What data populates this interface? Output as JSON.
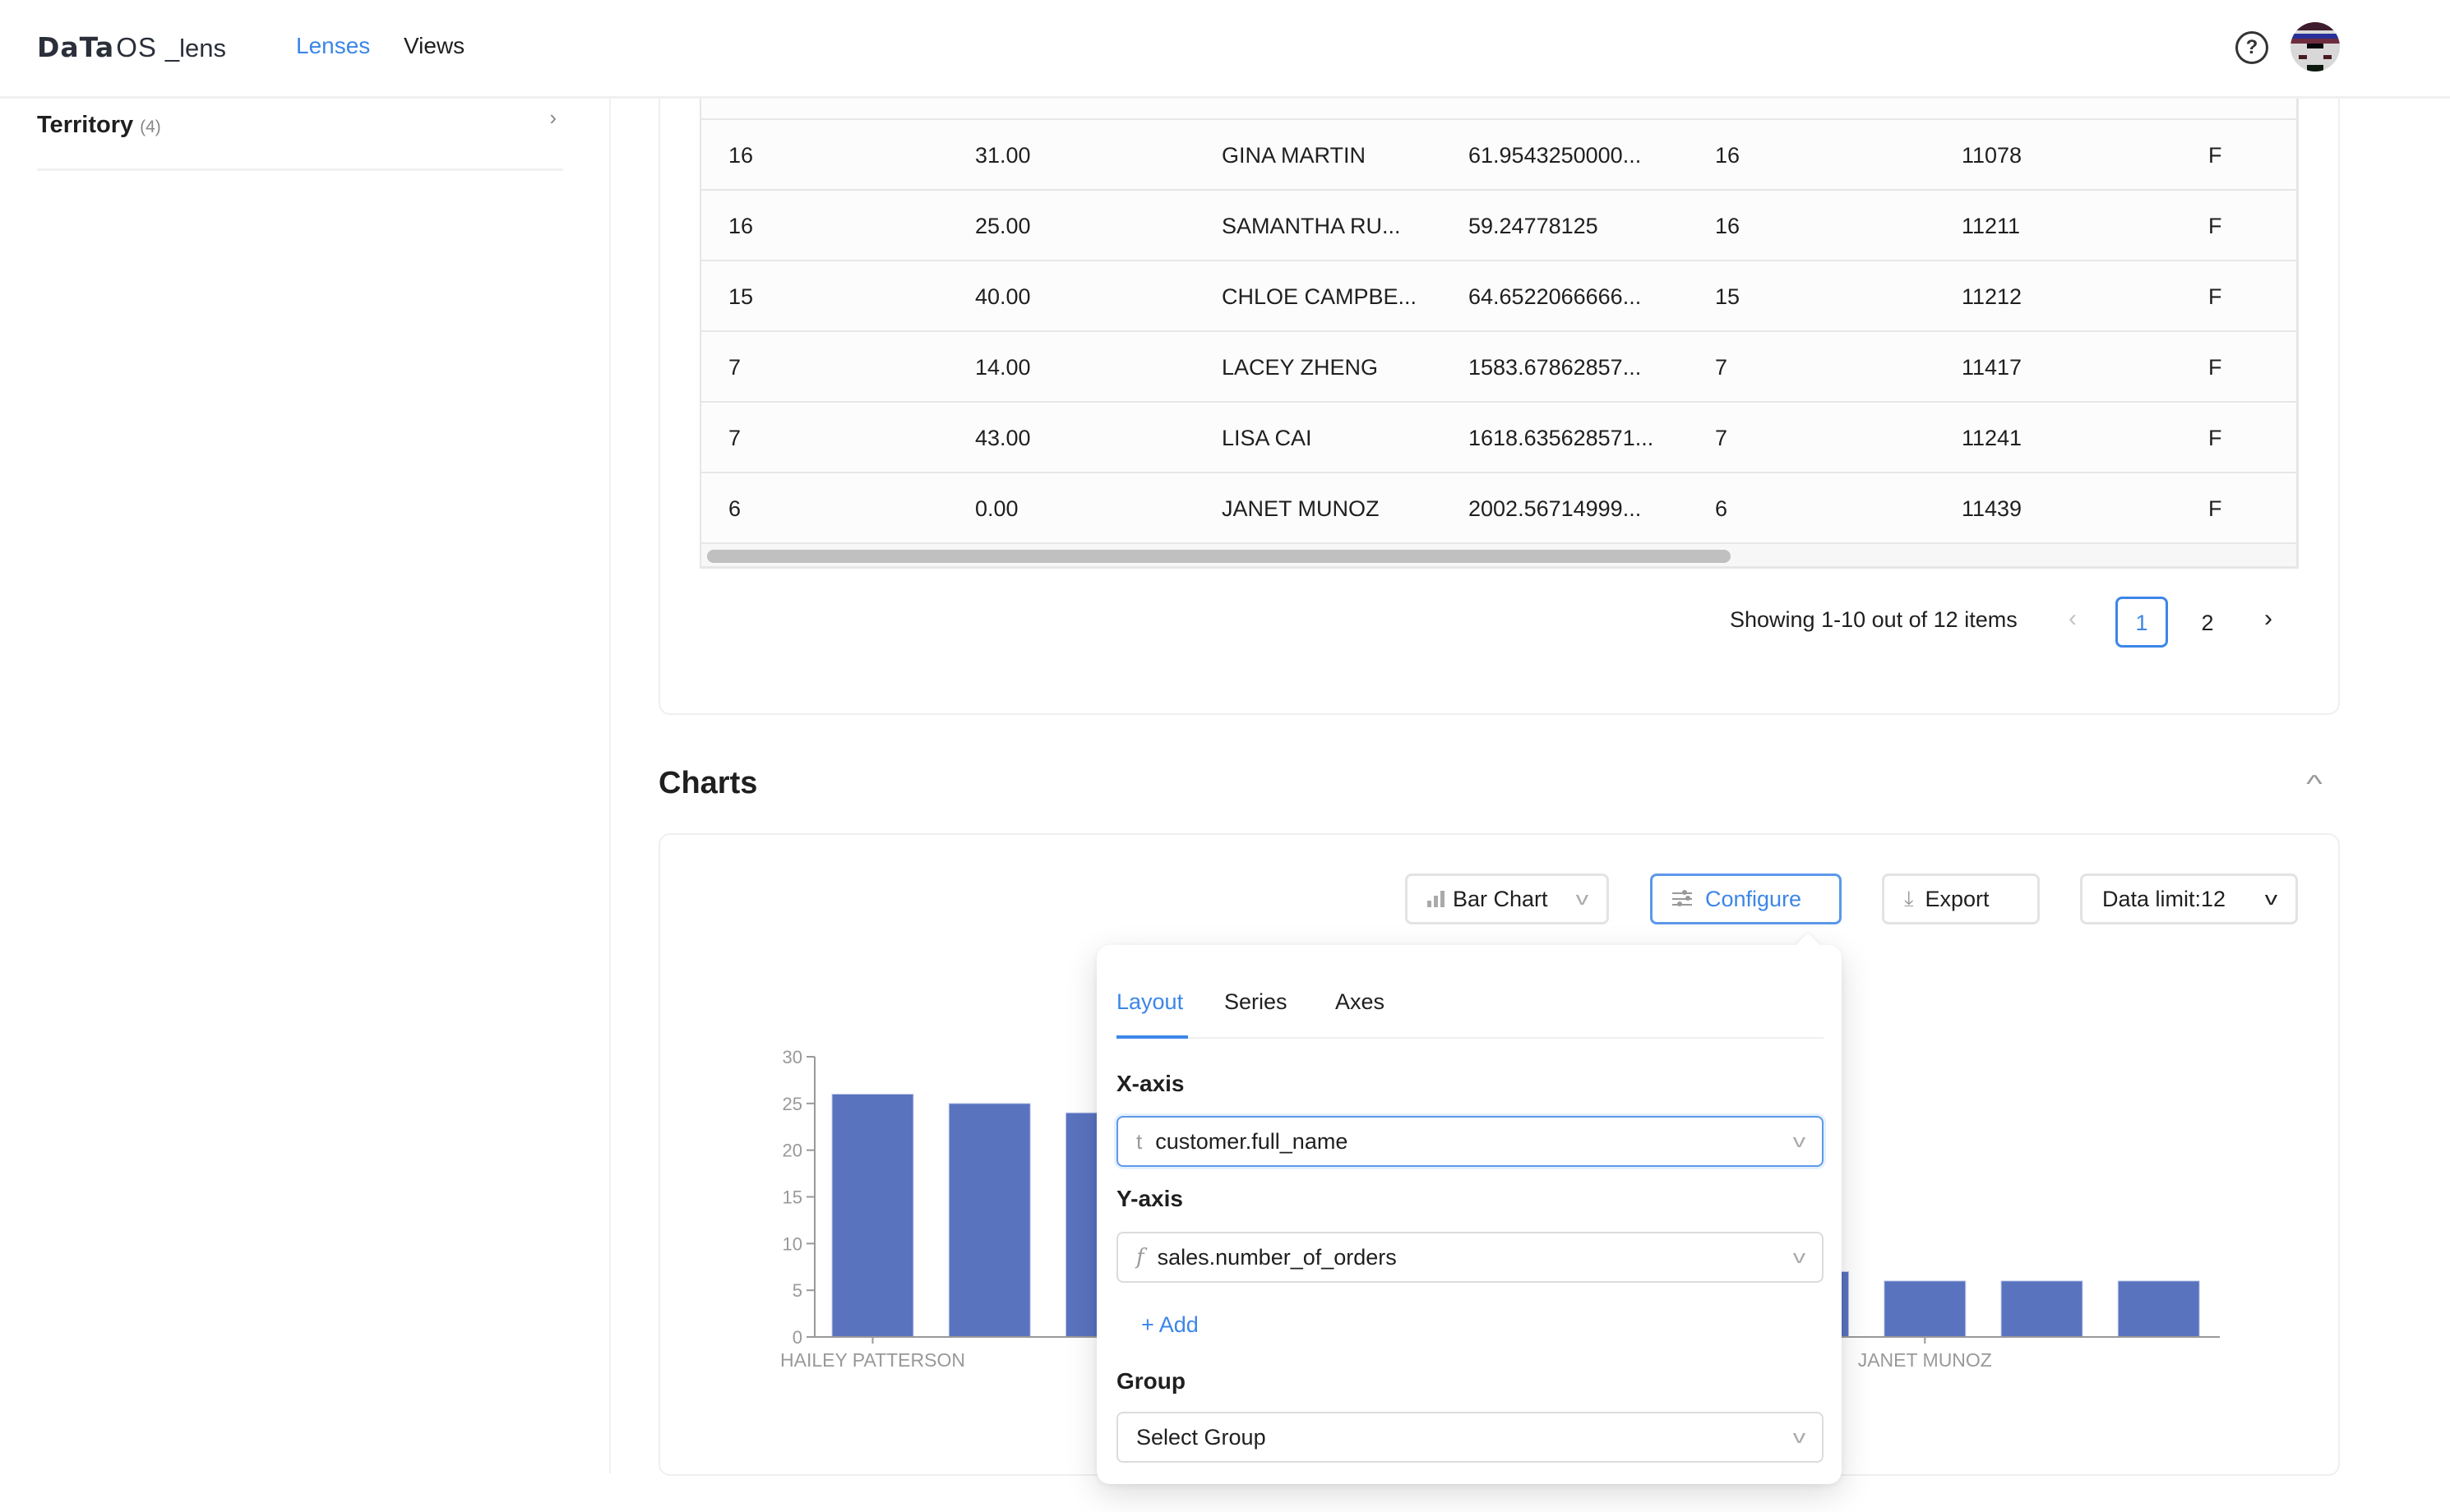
{
  "header": {
    "logo": {
      "bold": "DaTa",
      "light": "OS",
      "suffix": "_lens"
    },
    "nav": [
      {
        "label": "Lenses",
        "active": true
      },
      {
        "label": "Views",
        "active": false
      }
    ],
    "help_icon": "?",
    "avatar": "user-avatar"
  },
  "sidebar": {
    "items": [
      {
        "label": "Territory",
        "count": "(4)",
        "chevron": "›"
      }
    ]
  },
  "table": {
    "rows": [
      [
        "16",
        "31.00",
        "GINA MARTIN",
        "61.9543250000...",
        "16",
        "11078",
        "F"
      ],
      [
        "16",
        "25.00",
        "SAMANTHA RU...",
        "59.24778125",
        "16",
        "11211",
        "F"
      ],
      [
        "15",
        "40.00",
        "CHLOE CAMPBE...",
        "64.6522066666...",
        "15",
        "11212",
        "F"
      ],
      [
        "7",
        "14.00",
        "LACEY ZHENG",
        "1583.67862857...",
        "7",
        "11417",
        "F"
      ],
      [
        "7",
        "43.00",
        "LISA CAI",
        "1618.635628571...",
        "7",
        "11241",
        "F"
      ],
      [
        "6",
        "0.00",
        "JANET MUNOZ",
        "2002.56714999...",
        "6",
        "11439",
        "F"
      ]
    ],
    "pagination": {
      "summary": "Showing 1-10 out of 12 items",
      "prev": "‹",
      "pages": [
        "1",
        "2"
      ],
      "current": "1",
      "next": "›"
    }
  },
  "charts": {
    "title": "Charts",
    "collapse_icon": "^",
    "toolbar": {
      "chart_type": "Bar Chart",
      "configure": "Configure",
      "export": "Export",
      "data_limit": "Data limit:12"
    },
    "config_popup": {
      "tabs": [
        {
          "label": "Layout",
          "active": true
        },
        {
          "label": "Series",
          "active": false
        },
        {
          "label": "Axes",
          "active": false
        }
      ],
      "x_axis": {
        "label": "X-axis",
        "type_glyph": "t",
        "value": "customer.full_name"
      },
      "y_axis": {
        "label": "Y-axis",
        "type_glyph": "f",
        "value": "sales.number_of_orders"
      },
      "add_label": "+ Add",
      "group": {
        "label": "Group",
        "placeholder": "Select Group"
      }
    }
  },
  "colors": {
    "accent": "#3c86e8",
    "bar": "#5a73be",
    "axis": "#999999"
  },
  "chart_data": {
    "type": "bar",
    "title": "",
    "xlabel": "",
    "ylabel": "",
    "ylim": [
      0,
      30
    ],
    "yticks": [
      0,
      5,
      10,
      15,
      20,
      25,
      30
    ],
    "categories_count": 12,
    "visible_tick_labels": [
      {
        "index": 0,
        "label": "HAILEY PATTERSON"
      },
      {
        "index": 9,
        "label": "JANET MUNOZ"
      }
    ],
    "values": [
      26,
      25,
      24,
      null,
      null,
      null,
      null,
      null,
      7,
      6,
      6,
      6
    ],
    "grid": false,
    "legend": "none"
  }
}
